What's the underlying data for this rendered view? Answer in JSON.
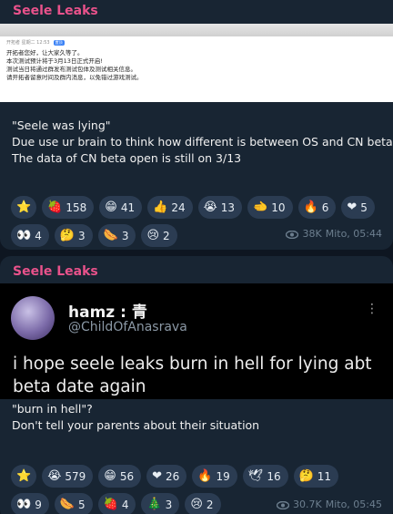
{
  "messages": [
    {
      "channel": "Seele Leaks",
      "image": {
        "meta_name": "开拓者 星期二 12:53",
        "meta_tag": "置顶",
        "lines": [
          "开拓者您好，让大家久等了。",
          "本次测试预计将于3月13日正式开启!",
          "测试当日将通过群发布测试包体及测试相关信息。",
          "请开拓者留意时间及群内消息，以免错过游戏测试。"
        ]
      },
      "text": [
        "\"Seele was lying\"",
        "Due use ur brain to think how different is between OS and CN beta",
        "The data of CN beta open is still on 3/13"
      ],
      "reactions": [
        {
          "emoji": "⭐",
          "count": ""
        },
        {
          "emoji": "🍓",
          "count": "158"
        },
        {
          "emoji": "😁",
          "count": "41"
        },
        {
          "emoji": "👍",
          "count": "24"
        },
        {
          "emoji": "😭",
          "count": "13"
        },
        {
          "emoji": "🫲",
          "count": "10"
        },
        {
          "emoji": "🔥",
          "count": "6"
        },
        {
          "emoji": "❤",
          "count": "5"
        },
        {
          "emoji": "👀",
          "count": "4"
        },
        {
          "emoji": "🤔",
          "count": "3"
        },
        {
          "emoji": "🌭",
          "count": "3"
        },
        {
          "emoji": "😢",
          "count": "2"
        }
      ],
      "views": "38K",
      "author_time": "Mito, 05:44"
    },
    {
      "channel": "Seele Leaks",
      "tweet": {
        "name": "hamz : 青",
        "handle": "@ChildOfAnasrava",
        "body": "i hope seele leaks burn in hell for lying abt beta date again"
      },
      "text": [
        "\"burn in hell\"?",
        "Don't tell your parents about their situation"
      ],
      "reactions": [
        {
          "emoji": "⭐",
          "count": ""
        },
        {
          "emoji": "😭",
          "count": "579"
        },
        {
          "emoji": "😁",
          "count": "56"
        },
        {
          "emoji": "❤",
          "count": "26"
        },
        {
          "emoji": "🔥",
          "count": "19"
        },
        {
          "emoji": "🕊",
          "count": "16"
        },
        {
          "emoji": "🤔",
          "count": "11"
        },
        {
          "emoji": "👀",
          "count": "9"
        },
        {
          "emoji": "🌭",
          "count": "5"
        },
        {
          "emoji": "🍓",
          "count": "4"
        },
        {
          "emoji": "🎄",
          "count": "3"
        },
        {
          "emoji": "😢",
          "count": "2"
        }
      ],
      "views": "30.7K",
      "author_time": "Mito, 05:45"
    }
  ],
  "colors": {
    "background": "#0e1621",
    "bubble": "#182533",
    "channel_name": "#e9528b",
    "chip": "#2b3c52",
    "meta": "#6d7f8f"
  }
}
